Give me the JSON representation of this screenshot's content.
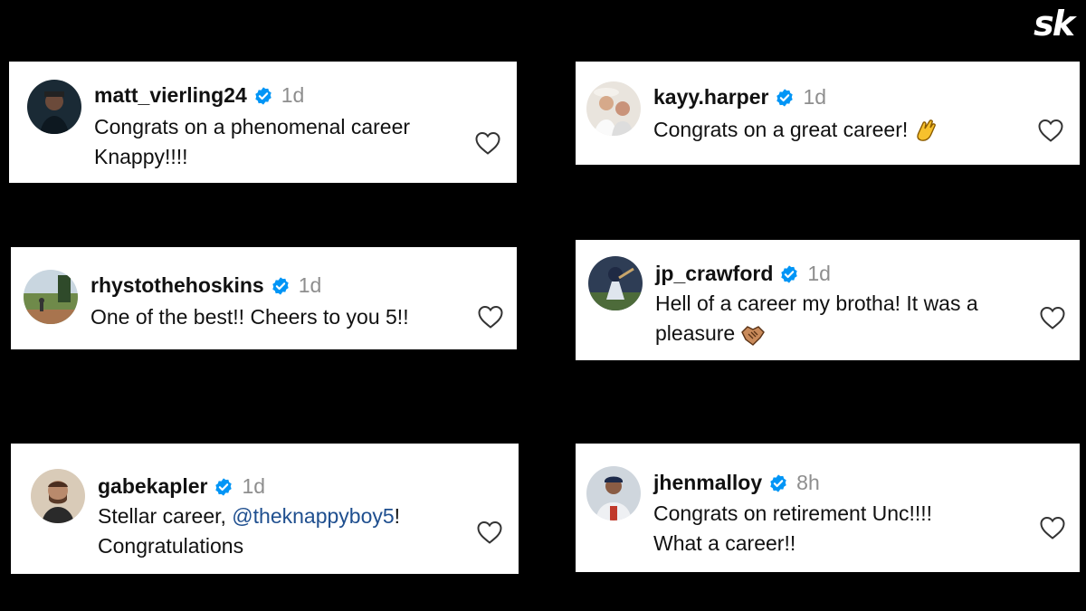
{
  "brand": {
    "logo_text": "sk"
  },
  "comments": [
    {
      "username": "matt_vierling24",
      "time": "1d",
      "lines": [
        "Congrats on a phenomenal career",
        "Knappy!!!!"
      ],
      "avatar_icon": "person-avatar-icon"
    },
    {
      "username": "kayy.harper",
      "time": "1d",
      "text": "Congrats on a great career!",
      "emoji": "clapping-hands-icon",
      "avatar_icon": "couple-avatar-icon"
    },
    {
      "username": "rhystothehoskins",
      "time": "1d",
      "text": "One of the best!! Cheers to you 5!!",
      "avatar_icon": "field-avatar-icon"
    },
    {
      "username": "jp_crawford",
      "time": "1d",
      "lines": [
        "Hell of a career my brotha! It was a",
        "pleasure"
      ],
      "emoji": "handshake-icon",
      "avatar_icon": "ballplayer-avatar-icon"
    },
    {
      "username": "gabekapler",
      "time": "1d",
      "text_prefix": "Stellar career, ",
      "mention": "@theknappyboy5",
      "text_suffix": "!",
      "line2": "Congratulations",
      "avatar_icon": "person-avatar-icon"
    },
    {
      "username": "jhenmalloy",
      "time": "8h",
      "lines": [
        "Congrats on retirement Unc!!!!",
        "What a career!!"
      ],
      "avatar_icon": "ballplayer-avatar-icon"
    }
  ],
  "colors": {
    "verified": "#0095f6",
    "mention": "#1f4f8f",
    "time": "#8e8e8e",
    "background": "#000000"
  }
}
